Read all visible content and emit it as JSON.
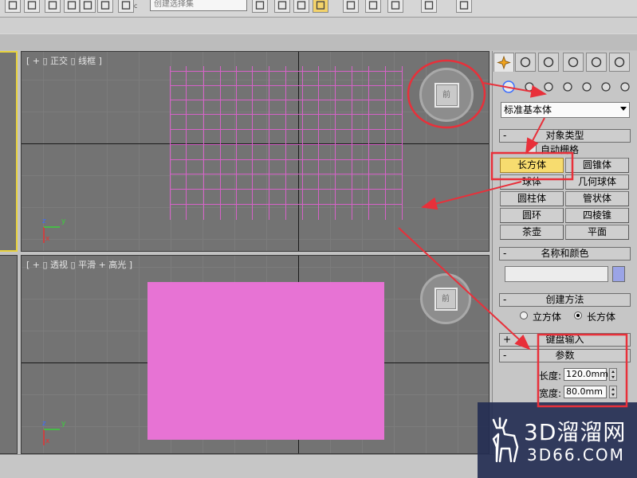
{
  "colors": {
    "viewport_bg": "#737373",
    "wireframe": "#d662c8",
    "box_fill": "#e773d4",
    "active_button": "#f7dc6f",
    "annotation_red": "#e8303a",
    "selection_border": "#e8d23c",
    "watermark_bg": "#242e52"
  },
  "toolbar": {
    "icons": [
      "link-icon",
      "unlink-icon",
      "bind-icon",
      "select-icon",
      "select-filter-icon",
      "select-by-name-icon",
      "named-selection-icon",
      "mirror-icon",
      "align-icon",
      "layer-icon",
      "curve-editor-icon",
      "schematic-icon",
      "material-editor-icon",
      "render-setup-icon",
      "render-frame-icon",
      "render-icon"
    ],
    "named_selection_placeholder": "创建选择集",
    "abc_label": "ABC"
  },
  "viewports": {
    "front": {
      "label": "[ + ▯ 正交 ▯ 线框 ]"
    },
    "perspective": {
      "label": "[ + ▯ 透视 ▯ 平滑 + 高光 ]"
    },
    "axes": {
      "z": "z",
      "y": "y",
      "x": "x"
    },
    "viewcube_face": "前"
  },
  "command_panel": {
    "tabs": [
      "create-icon",
      "modify-icon",
      "hierarchy-icon",
      "motion-icon",
      "display-icon",
      "utilities-icon"
    ],
    "subtabs": [
      "geometry-icon",
      "shapes-icon",
      "lights-icon",
      "cameras-icon",
      "helpers-icon",
      "space-warps-icon",
      "systems-icon"
    ],
    "category_dropdown": "标准基本体",
    "object_type": {
      "title": "对象类型",
      "autogrid": "自动栅格",
      "buttons": [
        [
          "长方体",
          "圆锥体"
        ],
        [
          "球体",
          "几何球体"
        ],
        [
          "圆柱体",
          "管状体"
        ],
        [
          "圆环",
          "四棱锥"
        ],
        [
          "茶壶",
          "平面"
        ]
      ]
    },
    "name_color": {
      "title": "名称和颜色",
      "name_value": "",
      "color": "#9ba4e6"
    },
    "creation_method": {
      "title": "创建方法",
      "options": [
        "立方体",
        "长方体"
      ],
      "selected": "长方体"
    },
    "keyboard_entry": {
      "title": "键盘输入",
      "sign": "+"
    },
    "parameters": {
      "title": "参数",
      "sign": "-",
      "length_label": "长度:",
      "length_value": "120.0mm",
      "width_label": "宽度:",
      "width_value": "80.0mm"
    },
    "collapse_sign": "-"
  },
  "watermark": {
    "title": "3D溜溜网",
    "url": "3D66.COM"
  }
}
